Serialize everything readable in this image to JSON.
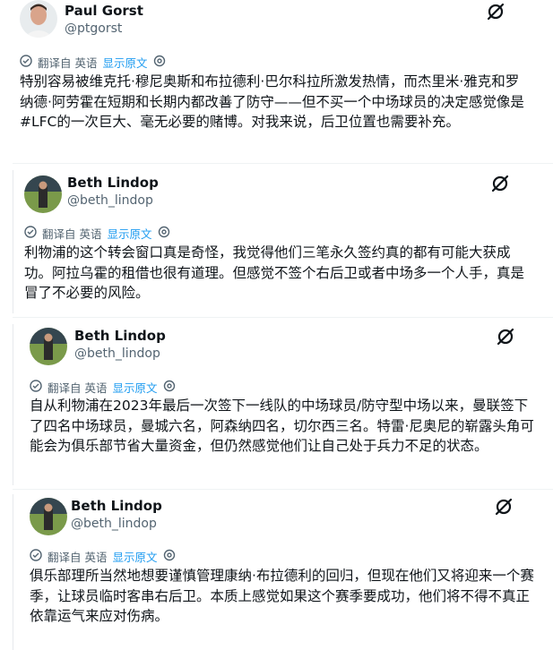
{
  "tweets": [
    {
      "name": "Paul Gorst",
      "handle": "@ptgorst",
      "translate_label": "翻译自 英语",
      "show_original": "显示原文",
      "text": "特别容易被维克托·穆尼奥斯和布拉德利·巴尔科拉所激发热情，而杰里米·雅克和罗纳德·阿劳霍在短期和长期内都改善了防守——但不买一个中场球员的决定感觉像是#LFC的一次巨大、毫无必要的赌博。对我来说，后卫位置也需要补充。"
    },
    {
      "name": "Beth Lindop",
      "handle": "@beth_lindop",
      "translate_label": "翻译自 英语",
      "show_original": "显示原文",
      "text": "利物浦的这个转会窗口真是奇怪，我觉得他们三笔永久签约真的都有可能大获成功。阿拉乌霍的租借也很有道理。但感觉不签个右后卫或者中场多一个人手，真是冒了不必要的风险。"
    },
    {
      "name": "Beth Lindop",
      "handle": "@beth_lindop",
      "translate_label": "翻译自 英语",
      "show_original": "显示原文",
      "text": "自从利物浦在2023年最后一次签下一线队的中场球员/防守型中场以来，曼联签下了四名中场球员，曼城六名，阿森纳四名，切尔西三名。特雷·尼奥尼的崭露头角可能会为俱乐部节省大量资金，但仍然感觉他们让自己处于兵力不足的状态。"
    },
    {
      "name": "Beth Lindop",
      "handle": "@beth_lindop",
      "translate_label": "翻译自 英语",
      "show_original": "显示原文",
      "text": "俱乐部理所当然地想要谨慎管理康纳·布拉德利的回归，但现在他们又将迎来一个赛季，让球员临时客串右后卫。本质上感觉如果这个赛季要成功，他们将不得不真正依靠运气来应对伤病。"
    }
  ]
}
